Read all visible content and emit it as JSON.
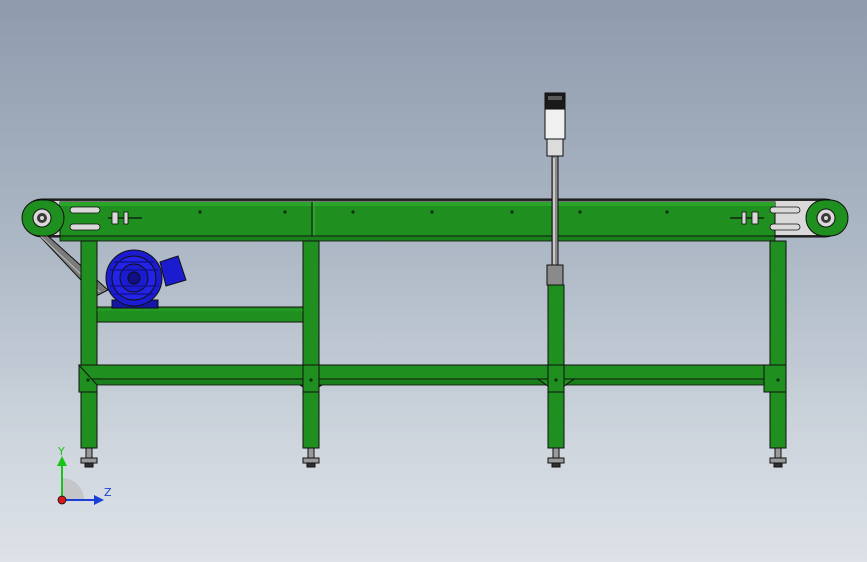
{
  "viewport": {
    "background_top": "#8e9bad",
    "background_bottom": "#dde2e8"
  },
  "model": {
    "frame_color": "#1f8f1f",
    "frame_highlight": "#2aa52a",
    "edge_color": "#101010",
    "motor_color": "#1b1bd0",
    "sensor_body_color": "#f0f0f0",
    "sensor_cap_color": "#1a1a1a",
    "rod_color": "#8a8a8a"
  },
  "triad": {
    "y_label": "Y",
    "z_label": "Z",
    "y_color": "#19c419",
    "z_color": "#1a3fd6",
    "x_color": "#d61a1a"
  }
}
